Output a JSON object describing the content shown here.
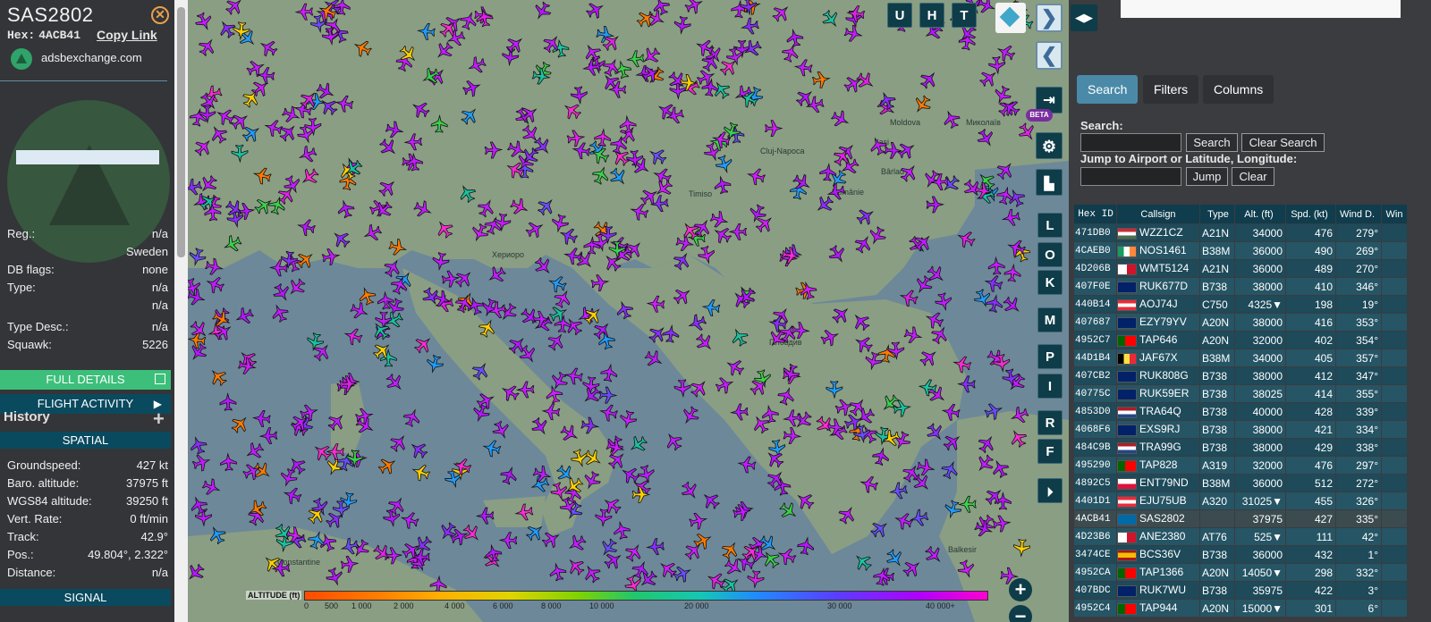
{
  "aircraft": {
    "callsign": "SAS2802",
    "hex_label": "Hex:",
    "hex": "4ACB41",
    "copy_link": "Copy Link",
    "source": "adsbexchange.com"
  },
  "details": [
    {
      "key": "Reg.:",
      "value": "n/a"
    },
    {
      "key": "",
      "value": "Sweden"
    },
    {
      "key": "DB flags:",
      "value": "none"
    },
    {
      "key": "Type:",
      "value": "n/a"
    },
    {
      "key": "",
      "value": "n/a"
    },
    {
      "key": "Type Desc.:",
      "value": "n/a"
    },
    {
      "key": "Squawk:",
      "value": "5226"
    }
  ],
  "buttons": {
    "full_details": "FULL DETAILS",
    "flight_activity": "FLIGHT ACTIVITY"
  },
  "history": {
    "title": "History",
    "spatial": "SPATIAL",
    "signal": "SIGNAL"
  },
  "spatial": [
    {
      "key": "Groundspeed:",
      "value": "427 kt"
    },
    {
      "key": "Baro. altitude:",
      "value": "37975 ft"
    },
    {
      "key": "WGS84 altitude:",
      "value": "39250 ft"
    },
    {
      "key": "Vert. Rate:",
      "value": "0 ft/min"
    },
    {
      "key": "Track:",
      "value": "42.9°"
    },
    {
      "key": "Pos.:",
      "value": "49.804°, 2.322°"
    },
    {
      "key": "Distance:",
      "value": "n/a"
    }
  ],
  "map": {
    "top_buttons": [
      "U",
      "H",
      "T"
    ],
    "side_buttons": [
      "L",
      "O",
      "K",
      "M",
      "P",
      "I",
      "R",
      "F"
    ],
    "beta": "BETA",
    "zoom_in": "+",
    "zoom_out": "−",
    "nav_forward": "❯",
    "nav_back": "❮",
    "altitude_title": "ALTITUDE (ft)",
    "altitude_ticks": [
      "0",
      "500",
      "1 000",
      "2 000",
      "4 000",
      "6 000",
      "8 000",
      "10 000",
      "20 000",
      "30 000",
      "40 000+"
    ],
    "place_labels": [
      "Cluj-Napoca",
      "Românie",
      "Пловдив",
      "Constantine",
      "Ваlkesir",
      "Хериоро",
      "Timiso",
      "Moldova",
      "Iași",
      "Миколаїв",
      "Bârlad"
    ]
  },
  "right": {
    "expand": "◀▶",
    "tabs": [
      "Search",
      "Filters",
      "Columns"
    ],
    "search_label": "Search:",
    "search_button": "Search",
    "clear_search_button": "Clear Search",
    "jump_label": "Jump to Airport or Latitude, Longitude:",
    "jump_button": "Jump",
    "clear_button": "Clear",
    "search_value": "",
    "jump_value": ""
  },
  "table": {
    "headers": [
      "Hex ID",
      "Callsign",
      "Type",
      "Alt. (ft)",
      "Spd. (kt)",
      "Wind D.",
      "Win"
    ],
    "rows": [
      {
        "hex": "471DB0",
        "flag": "hungary",
        "call": "WZZ1CZ",
        "type": "A21N",
        "alt": "34000",
        "spd": "476",
        "wind": "279°"
      },
      {
        "hex": "4CAEB0",
        "flag": "ireland",
        "call": "NOS1461",
        "type": "B38M",
        "alt": "36000",
        "spd": "490",
        "wind": "269°"
      },
      {
        "hex": "4D206B",
        "flag": "malta",
        "call": "WMT5124",
        "type": "A21N",
        "alt": "36000",
        "spd": "489",
        "wind": "270°"
      },
      {
        "hex": "407F0E",
        "flag": "uk",
        "call": "RUK677D",
        "type": "B738",
        "alt": "38000",
        "spd": "410",
        "wind": "346°"
      },
      {
        "hex": "440B14",
        "flag": "austria",
        "call": "AOJ74J",
        "type": "C750",
        "alt": "4325▼",
        "spd": "198",
        "wind": "19°"
      },
      {
        "hex": "407687",
        "flag": "uk",
        "call": "EZY79YV",
        "type": "A20N",
        "alt": "38000",
        "spd": "416",
        "wind": "353°"
      },
      {
        "hex": "4952C7",
        "flag": "portugal",
        "call": "TAP646",
        "type": "A20N",
        "alt": "32000",
        "spd": "402",
        "wind": "354°"
      },
      {
        "hex": "44D1B4",
        "flag": "belgium",
        "call": "JAF67X",
        "type": "B38M",
        "alt": "34000",
        "spd": "405",
        "wind": "357°"
      },
      {
        "hex": "407CB2",
        "flag": "uk",
        "call": "RUK808G",
        "type": "B738",
        "alt": "38000",
        "spd": "412",
        "wind": "347°"
      },
      {
        "hex": "40775C",
        "flag": "uk",
        "call": "RUK59ER",
        "type": "B738",
        "alt": "38025",
        "spd": "414",
        "wind": "355°"
      },
      {
        "hex": "4853D0",
        "flag": "netherlands",
        "call": "TRA64Q",
        "type": "B738",
        "alt": "40000",
        "spd": "428",
        "wind": "339°"
      },
      {
        "hex": "4068F6",
        "flag": "uk",
        "call": "EXS9RJ",
        "type": "B738",
        "alt": "38000",
        "spd": "421",
        "wind": "334°"
      },
      {
        "hex": "484C9B",
        "flag": "netherlands",
        "call": "TRA99G",
        "type": "B738",
        "alt": "38000",
        "spd": "429",
        "wind": "338°"
      },
      {
        "hex": "495290",
        "flag": "portugal",
        "call": "TAP828",
        "type": "A319",
        "alt": "32000",
        "spd": "476",
        "wind": "297°"
      },
      {
        "hex": "4892C5",
        "flag": "poland",
        "call": "ENT79ND",
        "type": "B38M",
        "alt": "36000",
        "spd": "512",
        "wind": "272°"
      },
      {
        "hex": "4401D1",
        "flag": "austria",
        "call": "EJU75UB",
        "type": "A320",
        "alt": "31025▼",
        "spd": "455",
        "wind": "326°"
      },
      {
        "hex": "4ACB41",
        "flag": "sweden",
        "call": "SAS2802",
        "type": "",
        "alt": "37975",
        "spd": "427",
        "wind": "335°",
        "selected": true
      },
      {
        "hex": "4D23B6",
        "flag": "malta",
        "call": "ANE2380",
        "type": "AT76",
        "alt": "525▼",
        "spd": "111",
        "wind": "42°"
      },
      {
        "hex": "3474CE",
        "flag": "spain",
        "call": "BCS36V",
        "type": "B738",
        "alt": "36000",
        "spd": "432",
        "wind": "1°"
      },
      {
        "hex": "4952CA",
        "flag": "portugal",
        "call": "TAP1366",
        "type": "A20N",
        "alt": "14050▼",
        "spd": "298",
        "wind": "332°"
      },
      {
        "hex": "407BDC",
        "flag": "uk",
        "call": "RUK7WU",
        "type": "B738",
        "alt": "35975",
        "spd": "422",
        "wind": "3°"
      },
      {
        "hex": "4952C4",
        "flag": "portugal",
        "call": "TAP944",
        "type": "A20N",
        "alt": "15000▼",
        "spd": "301",
        "wind": "6°"
      }
    ]
  },
  "colors": {
    "accent_green": "#3cbf7a",
    "panel_teal": "#0a4a5f",
    "map_water": "#6d8899",
    "map_land": "#8a9e84"
  }
}
